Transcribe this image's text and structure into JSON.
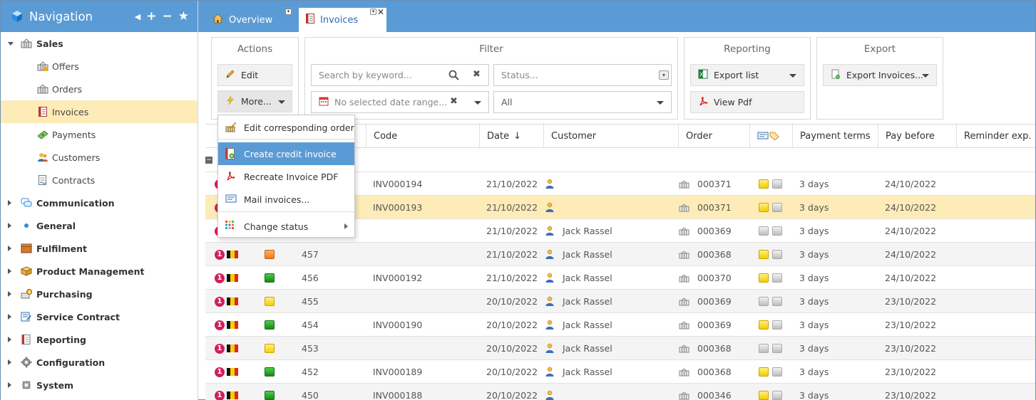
{
  "sidebar": {
    "title": "Navigation",
    "items": [
      {
        "label": "Sales",
        "type": "group",
        "expanded": true,
        "icon": "basket-icon"
      },
      {
        "label": "Offers",
        "type": "sub",
        "icon": "offer-basket-icon"
      },
      {
        "label": "Orders",
        "type": "sub",
        "icon": "order-basket-icon"
      },
      {
        "label": "Invoices",
        "type": "sub",
        "icon": "invoice-icon",
        "active": true
      },
      {
        "label": "Payments",
        "type": "sub",
        "icon": "money-icon"
      },
      {
        "label": "Customers",
        "type": "sub",
        "icon": "customers-icon"
      },
      {
        "label": "Contracts",
        "type": "sub",
        "icon": "contract-icon"
      },
      {
        "label": "Communication",
        "type": "group",
        "icon": "chat-icon"
      },
      {
        "label": "General",
        "type": "group",
        "icon": "dot-icon"
      },
      {
        "label": "Fulfilment",
        "type": "group",
        "icon": "box-icon"
      },
      {
        "label": "Product Management",
        "type": "group",
        "icon": "package-icon"
      },
      {
        "label": "Purchasing",
        "type": "group",
        "icon": "purchasing-icon"
      },
      {
        "label": "Service Contract",
        "type": "group",
        "icon": "service-contract-icon"
      },
      {
        "label": "Reporting",
        "type": "group",
        "icon": "report-icon"
      },
      {
        "label": "Configuration",
        "type": "group",
        "icon": "gear-icon"
      },
      {
        "label": "System",
        "type": "group",
        "icon": "system-gear-icon"
      }
    ]
  },
  "tabs": {
    "overview": "Overview",
    "invoices": "Invoices"
  },
  "actions": {
    "title": "Actions",
    "edit": "Edit",
    "more": "More..."
  },
  "filter": {
    "title": "Filter",
    "search_placeholder": "Search by keyword...",
    "status_placeholder": "Status...",
    "date_placeholder": "No selected date range...",
    "all_value": "All"
  },
  "reporting": {
    "title": "Reporting",
    "export_list": "Export list",
    "view_pdf": "View Pdf"
  },
  "export": {
    "title": "Export",
    "export_invoices": "Export Invoices..."
  },
  "dropdown": {
    "items": [
      "Edit corresponding order",
      "Create credit invoice",
      "Recreate Invoice PDF",
      "Mail invoices...",
      "Change status"
    ]
  },
  "grid": {
    "columns": {
      "code": "Code",
      "date": "Date",
      "customer": "Customer",
      "order": "Order",
      "payment_terms": "Payment terms",
      "pay_before": "Pay before",
      "reminder": "Reminder exp."
    },
    "rows": [
      {
        "num": "",
        "status": "",
        "code": "INV000194",
        "date": "21/10/2022",
        "customer": "",
        "order": "000371",
        "s1": "yellow",
        "s2": "grey",
        "terms": "3 days",
        "pay_before": "24/10/2022"
      },
      {
        "num": "",
        "status": "",
        "code": "INV000193",
        "date": "21/10/2022",
        "customer": "",
        "order": "000371",
        "s1": "yellow",
        "s2": "grey",
        "terms": "3 days",
        "pay_before": "24/10/2022"
      },
      {
        "num": "",
        "status": "",
        "code": "",
        "date": "21/10/2022",
        "customer": "Jack Rassel",
        "order": "000369",
        "s1": "grey",
        "s2": "grey",
        "terms": "3 days",
        "pay_before": "24/10/2022"
      },
      {
        "num": "457",
        "status": "orange",
        "code": "",
        "date": "21/10/2022",
        "customer": "Jack Rassel",
        "order": "000368",
        "s1": "yellow",
        "s2": "grey",
        "terms": "3 days",
        "pay_before": "24/10/2022"
      },
      {
        "num": "456",
        "status": "green",
        "code": "INV000192",
        "date": "21/10/2022",
        "customer": "Jack Rassel",
        "order": "000370",
        "s1": "yellow",
        "s2": "grey",
        "terms": "3 days",
        "pay_before": "24/10/2022"
      },
      {
        "num": "455",
        "status": "lyellow",
        "code": "",
        "date": "20/10/2022",
        "customer": "Jack Rassel",
        "order": "000369",
        "s1": "grey",
        "s2": "grey",
        "terms": "3 days",
        "pay_before": "23/10/2022"
      },
      {
        "num": "454",
        "status": "green",
        "code": "INV000190",
        "date": "20/10/2022",
        "customer": "Jack Rassel",
        "order": "000369",
        "s1": "yellow",
        "s2": "grey",
        "terms": "3 days",
        "pay_before": "23/10/2022"
      },
      {
        "num": "453",
        "status": "lyellow",
        "code": "",
        "date": "20/10/2022",
        "customer": "Jack Rassel",
        "order": "000368",
        "s1": "grey",
        "s2": "grey",
        "terms": "3 days",
        "pay_before": "23/10/2022"
      },
      {
        "num": "452",
        "status": "green",
        "code": "INV000189",
        "date": "20/10/2022",
        "customer": "Jack Rassel",
        "order": "000368",
        "s1": "yellow",
        "s2": "grey",
        "terms": "3 days",
        "pay_before": "23/10/2022"
      },
      {
        "num": "450",
        "status": "green",
        "code": "INV000188",
        "date": "20/10/2022",
        "customer": "",
        "order": "000346",
        "s1": "yellow",
        "s2": "grey",
        "terms": "3 days",
        "pay_before": "23/10/2022"
      }
    ]
  },
  "colors": {
    "accent": "#5b9bd5",
    "selected_row": "#fdebb8",
    "badge": "#d11f5a"
  }
}
